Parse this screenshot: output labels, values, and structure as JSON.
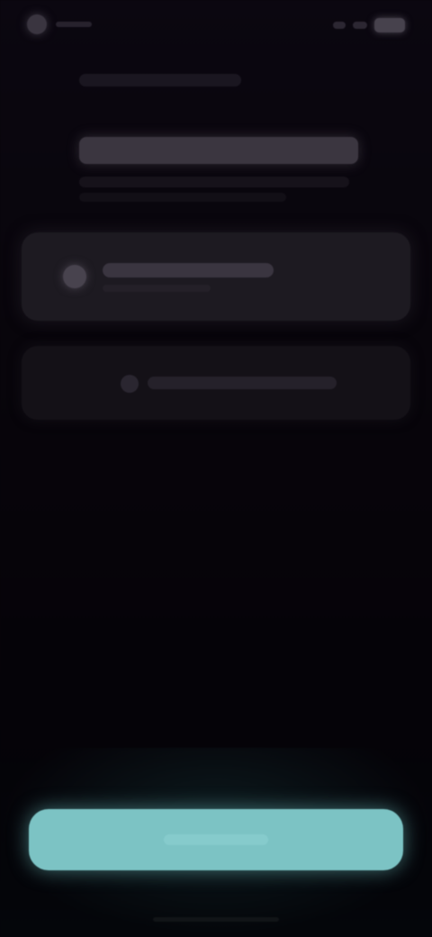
{
  "screen": {
    "title": "",
    "subtitle": ""
  },
  "status_bar": {
    "time": "",
    "icons": [
      "status-dot",
      "signal-icon",
      "wifi-icon",
      "battery-icon"
    ]
  },
  "header": {
    "back_icon": "chevron-left-icon",
    "subtitle": "",
    "title": "",
    "description": ""
  },
  "options": [
    {
      "icon": "circle-icon",
      "label": "",
      "sublabel": ""
    },
    {
      "icon": "circle-icon",
      "label": ""
    }
  ],
  "primary_button": {
    "label": "",
    "color": "#7cc3c4"
  },
  "colors": {
    "background": "#07040a",
    "card": "#1d1a21",
    "card_secondary": "#141117",
    "accent": "#7cc3c4"
  }
}
